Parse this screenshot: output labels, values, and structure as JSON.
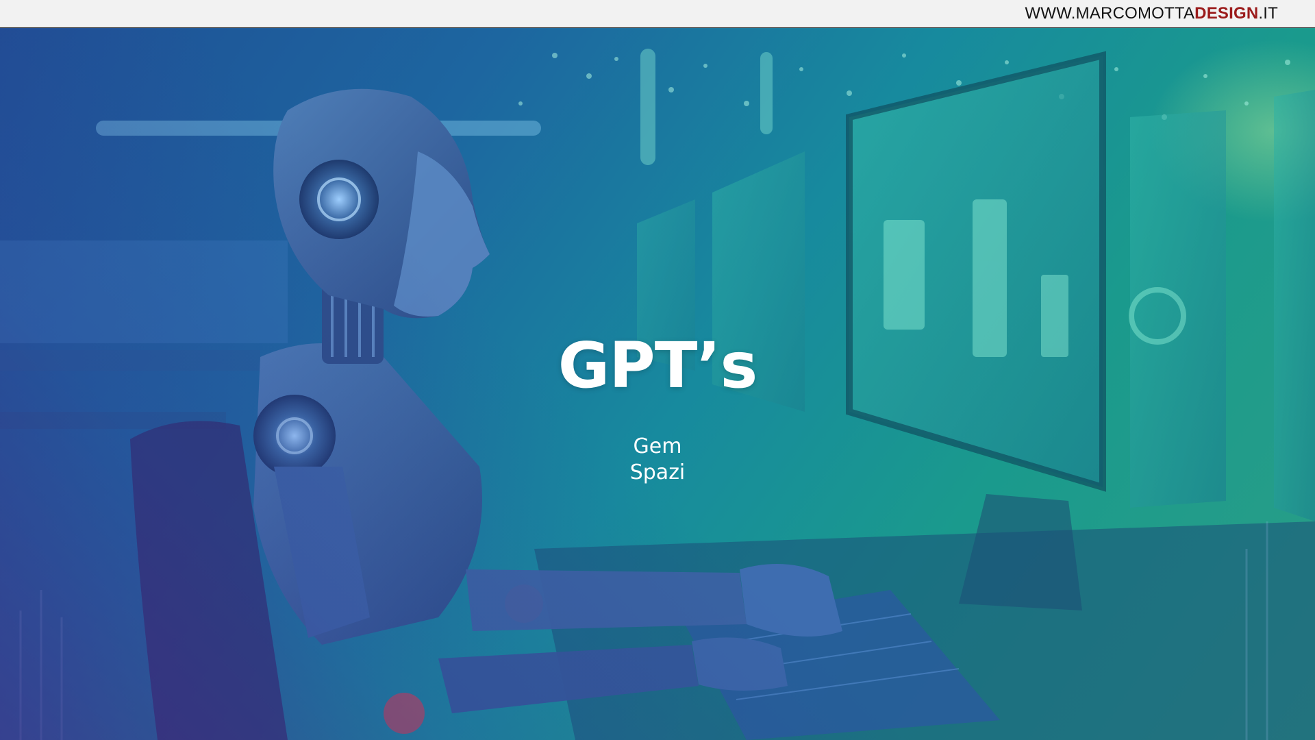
{
  "header": {
    "site_url_main": "WWW.MARCOMOTTA",
    "site_url_accent": "DESIGN",
    "site_url_tail": ".IT"
  },
  "slide": {
    "title": "GPT’s",
    "subtitle_items": [
      "Gem",
      "Spazi"
    ],
    "background_image": "humanoid-robot-at-computer-workstation",
    "colors": {
      "accent": "#9b1b1b",
      "overlay_teal": "#178a9e",
      "overlay_purple": "#4b2382"
    }
  }
}
